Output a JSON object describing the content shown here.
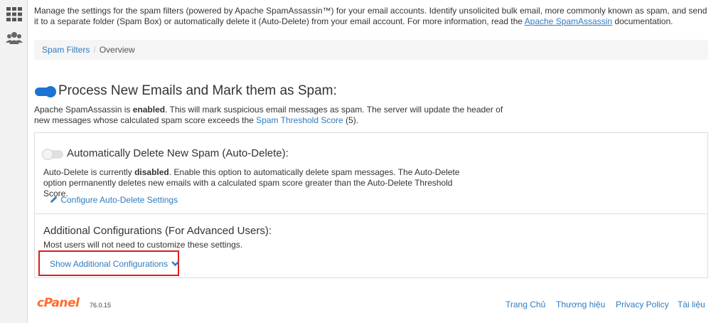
{
  "sidebar": {
    "items": [
      {
        "icon": "grid-icon"
      },
      {
        "icon": "users-icon"
      }
    ]
  },
  "intro": {
    "text_before": "Manage the settings for the spam filters (powered by Apache SpamAssassin™) for your email accounts. Identify unsolicited bulk email, more commonly known as spam, and send it to a separate folder (Spam Box) or automatically delete it (Auto-Delete) from your email account. For more information, read the ",
    "link": "Apache SpamAssassin",
    "text_after": " documentation."
  },
  "breadcrumb": {
    "items": [
      "Spam Filters",
      "Overview"
    ],
    "separator": "/"
  },
  "process": {
    "toggle_state": "on",
    "title": "Process New Emails and Mark them as Spam:",
    "desc_before": "Apache SpamAssassin is ",
    "desc_bold": "enabled",
    "desc_middle": ". This will mark suspicious email messages as spam. The server will update the header of new messages whose calculated spam score exceeds the ",
    "desc_link": "Spam Threshold Score",
    "desc_after": " (5)."
  },
  "auto_delete": {
    "toggle_state": "off",
    "title": "Automatically Delete New Spam (Auto-Delete):",
    "desc_before": "Auto-Delete is currently ",
    "desc_bold": "disabled",
    "desc_after": ". Enable this option to automatically delete spam messages. The Auto-Delete option permanently deletes new emails with a calculated spam score greater than the Auto-Delete Threshold Score.",
    "configure_link": "Configure Auto-Delete Settings",
    "configure_icon": "pencil-icon"
  },
  "additional": {
    "title": "Additional Configurations (For Advanced Users):",
    "desc": "Most users will not need to customize these settings.",
    "show_link": "Show Additional Configurations",
    "show_icon": "chevron-down-icon"
  },
  "footer": {
    "logo": "cPanel",
    "version": "76.0.15",
    "links": [
      "Trang Chủ",
      "Thương hiệu",
      "Privacy Policy",
      "Tài liệu"
    ]
  },
  "colors": {
    "link": "#2f7bbf",
    "toggle_on": "#1b73d2",
    "highlight": "#e31b1b",
    "logo": "#ff6c2c"
  }
}
